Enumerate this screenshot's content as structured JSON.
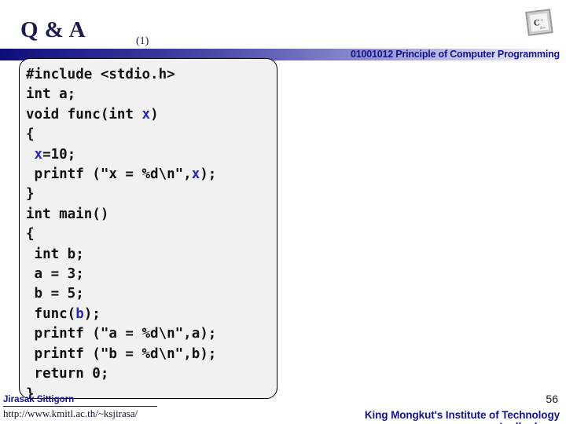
{
  "slide": {
    "title": "Q & A",
    "subtitle": "(1)",
    "course_title": "01001012 Principle of Computer Programming",
    "logo_icon": "tilted-square-c-logo-icon",
    "accent_color": "#14148c",
    "band_color": "#0d0d7a",
    "code_bg_color": "#f1f1f1",
    "variable_token_color": "#2727bb"
  },
  "code": {
    "language": "c",
    "lines": [
      {
        "segments": [
          {
            "text": "#include <stdio.h>",
            "type": "plain"
          }
        ]
      },
      {
        "segments": [
          {
            "text": "int a;",
            "type": "plain"
          }
        ]
      },
      {
        "segments": [
          {
            "text": "void func(int ",
            "type": "plain"
          },
          {
            "text": "x",
            "type": "var"
          },
          {
            "text": ")",
            "type": "plain"
          }
        ]
      },
      {
        "segments": [
          {
            "text": "{",
            "type": "plain"
          }
        ]
      },
      {
        "segments": [
          {
            "text": " ",
            "type": "plain"
          },
          {
            "text": "x",
            "type": "var"
          },
          {
            "text": "=10;",
            "type": "plain"
          }
        ]
      },
      {
        "segments": [
          {
            "text": " printf (\"x = %d\\n\",",
            "type": "plain"
          },
          {
            "text": "x",
            "type": "var"
          },
          {
            "text": ");",
            "type": "plain"
          }
        ]
      },
      {
        "segments": [
          {
            "text": "}",
            "type": "plain"
          }
        ]
      },
      {
        "segments": [
          {
            "text": "int main()",
            "type": "plain"
          }
        ]
      },
      {
        "segments": [
          {
            "text": "{",
            "type": "plain"
          }
        ]
      },
      {
        "segments": [
          {
            "text": " int b;",
            "type": "plain"
          }
        ]
      },
      {
        "segments": [
          {
            "text": " a = 3;",
            "type": "plain"
          }
        ]
      },
      {
        "segments": [
          {
            "text": " b = 5;",
            "type": "plain"
          }
        ]
      },
      {
        "segments": [
          {
            "text": " func(",
            "type": "plain"
          },
          {
            "text": "b",
            "type": "var"
          },
          {
            "text": ");",
            "type": "plain"
          }
        ]
      },
      {
        "segments": [
          {
            "text": " printf (\"a = %d\\n\",a);",
            "type": "plain"
          }
        ]
      },
      {
        "segments": [
          {
            "text": " printf (\"b = %d\\n\",b);",
            "type": "plain"
          }
        ]
      },
      {
        "segments": [
          {
            "text": " return 0;",
            "type": "plain"
          }
        ]
      },
      {
        "segments": [
          {
            "text": "}",
            "type": "plain"
          }
        ]
      }
    ]
  },
  "footer": {
    "author": "Jirasak Sittigorn",
    "url": "http://www.kmitl.ac.th/~ksjirasa/",
    "page_number": "56",
    "institute_line1": "King Mongkut's Institute of Technology",
    "institute_line2": "Ladkrabang"
  }
}
